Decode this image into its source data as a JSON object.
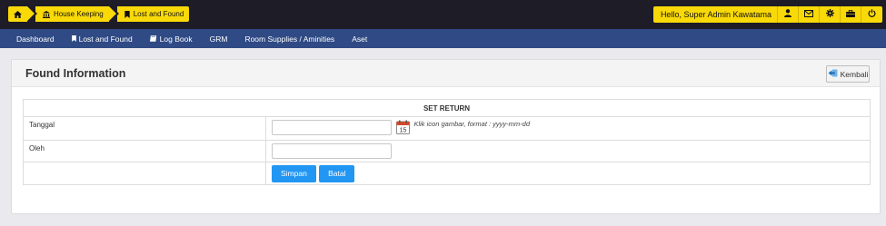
{
  "breadcrumb": {
    "home_icon": "home-icon",
    "items": [
      {
        "label": "House Keeping",
        "icon": "bank-icon"
      },
      {
        "label": "Lost and Found",
        "icon": "bookmark-icon"
      }
    ]
  },
  "user": {
    "greeting": "Hello, Super Admin Kawatama",
    "icons": [
      "user-icon",
      "mail-icon",
      "gear-icon",
      "briefcase-icon",
      "power-icon"
    ]
  },
  "nav": {
    "items": [
      {
        "label": "Dashboard"
      },
      {
        "label": "Lost and Found",
        "icon": "bookmark-icon"
      },
      {
        "label": "Log Book",
        "icon": "book-icon"
      },
      {
        "label": "GRM"
      },
      {
        "label": "Room Supplies / Aminities"
      },
      {
        "label": "Aset"
      }
    ]
  },
  "panel": {
    "title": "Found Information",
    "back_label": "Kembali"
  },
  "form": {
    "section_title": "SET RETURN",
    "tanggal_label": "Tanggal",
    "tanggal_value": "",
    "tanggal_hint": "Klik icon gambar, format : yyyy-mm-dd",
    "oleh_label": "Oleh",
    "oleh_value": "",
    "save_label": "Simpan",
    "cancel_label": "Batal"
  },
  "colors": {
    "topbar": "#1d1c27",
    "accent_yellow": "#f9d907",
    "nav_blue": "#2f4a84",
    "button_blue": "#2196f3"
  }
}
